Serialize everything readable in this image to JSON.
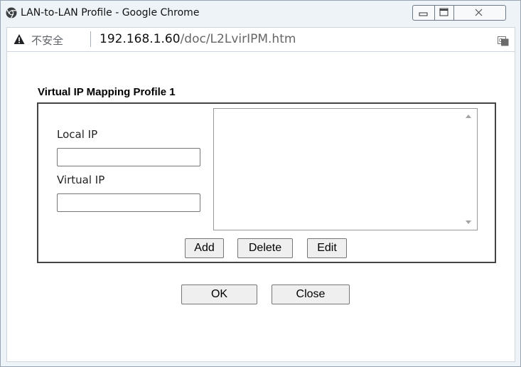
{
  "browser": {
    "window_title": "LAN-to-LAN Profile - Google Chrome",
    "security_label": "不安全",
    "url_host": "192.168.1.60",
    "url_path": "/doc/L2LvirIPM.htm"
  },
  "form": {
    "section_title": "Virtual IP Mapping Profile 1",
    "local_ip_label": "Local IP",
    "local_ip_value": "",
    "virtual_ip_label": "Virtual IP",
    "virtual_ip_value": "",
    "mapping_list": [],
    "add_label": "Add",
    "delete_label": "Delete",
    "edit_label": "Edit"
  },
  "footer": {
    "ok_label": "OK",
    "close_label": "Close"
  }
}
